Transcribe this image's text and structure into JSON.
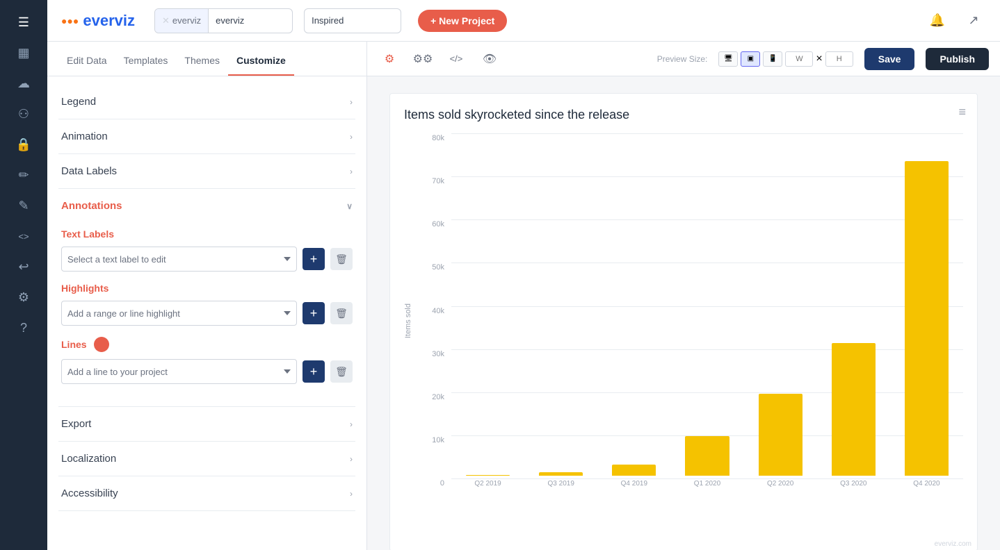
{
  "app": {
    "logo": "everviz",
    "logoIcon": "●●●"
  },
  "header": {
    "breadcrumb_tag": "everviz",
    "project_name": "everviz",
    "subtitle": "Inspired",
    "new_project_label": "+ New Project"
  },
  "tabs": {
    "items": [
      {
        "id": "edit-data",
        "label": "Edit Data"
      },
      {
        "id": "templates",
        "label": "Templates"
      },
      {
        "id": "themes",
        "label": "Themes"
      },
      {
        "id": "customize",
        "label": "Customize",
        "active": true
      }
    ]
  },
  "sidebar": {
    "sections": [
      {
        "id": "legend",
        "label": "Legend",
        "open": false
      },
      {
        "id": "animation",
        "label": "Animation",
        "open": false
      },
      {
        "id": "data-labels",
        "label": "Data Labels",
        "open": false
      },
      {
        "id": "annotations",
        "label": "Annotations",
        "open": true
      }
    ],
    "annotations": {
      "text_labels_title": "Text Labels",
      "text_label_placeholder": "Select a text label to edit",
      "highlights_title": "Highlights",
      "highlight_placeholder": "Add a range or line highlight",
      "lines_title": "Lines",
      "line_placeholder": "Add a line to your project"
    },
    "export": {
      "label": "Export"
    },
    "localization": {
      "label": "Localization"
    },
    "accessibility": {
      "label": "Accessibility"
    }
  },
  "toolbar": {
    "save_label": "Save",
    "publish_label": "Publish",
    "preview_size_label": "Preview Size:",
    "size_w": "W",
    "size_h": "×"
  },
  "chart": {
    "title": "Items sold skyrocketed since the release",
    "y_axis_label": "Items sold",
    "watermark": "everviz.com",
    "bars": [
      {
        "label": "Q2 2019",
        "value": 200,
        "max": 80000,
        "height_pct": 0.3
      },
      {
        "label": "Q3 2019",
        "value": 800,
        "max": 80000,
        "height_pct": 1.5
      },
      {
        "label": "Q4 2019",
        "value": 2500,
        "max": 80000,
        "height_pct": 3.5
      },
      {
        "label": "Q1 2020",
        "value": 9000,
        "max": 80000,
        "height_pct": 12
      },
      {
        "label": "Q2 2020",
        "value": 18500,
        "max": 80000,
        "height_pct": 24
      },
      {
        "label": "Q3 2020",
        "value": 30000,
        "max": 80000,
        "height_pct": 38
      },
      {
        "label": "Q4 2020",
        "value": 71000,
        "max": 80000,
        "height_pct": 89
      }
    ],
    "y_axis_ticks": [
      "0",
      "10k",
      "20k",
      "30k",
      "40k",
      "50k",
      "60k",
      "70k",
      "80k"
    ]
  },
  "nav_icons": [
    {
      "id": "menu",
      "symbol": "☰"
    },
    {
      "id": "bar-chart",
      "symbol": "📊"
    },
    {
      "id": "cloud",
      "symbol": "☁"
    },
    {
      "id": "users",
      "symbol": "👥"
    },
    {
      "id": "lock",
      "symbol": "🔒"
    },
    {
      "id": "pen",
      "symbol": "✏"
    },
    {
      "id": "edit",
      "symbol": "📝"
    },
    {
      "id": "code",
      "symbol": "<>"
    },
    {
      "id": "undo",
      "symbol": "↩"
    },
    {
      "id": "settings",
      "symbol": "⚙"
    },
    {
      "id": "help",
      "symbol": "?"
    }
  ]
}
